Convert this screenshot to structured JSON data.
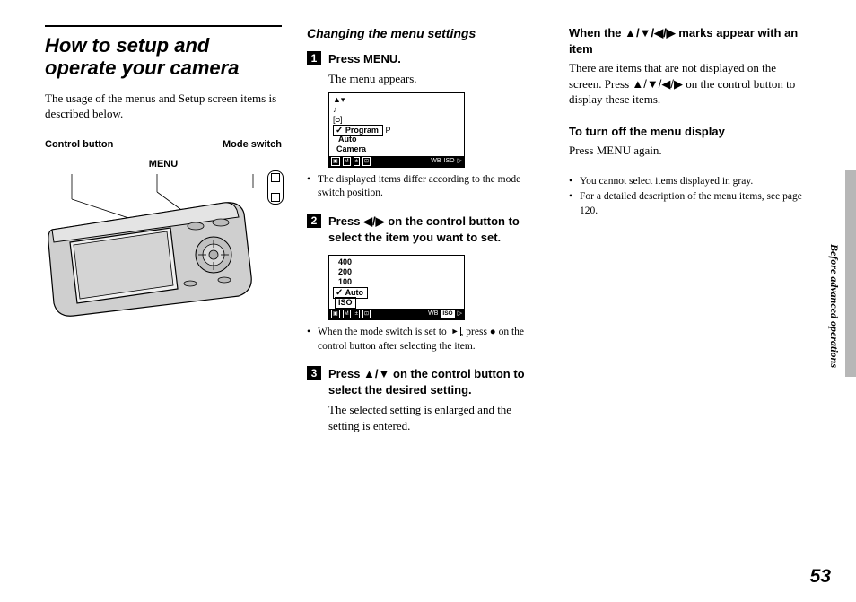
{
  "page_number": "53",
  "side_tab": "Before advanced operations",
  "col1": {
    "title": "How to setup and operate your camera",
    "intro": "The usage of the menus and Setup screen items is described below.",
    "labels": {
      "control_button": "Control button",
      "mode_switch": "Mode switch",
      "menu": "MENU"
    }
  },
  "col2": {
    "heading": "Changing the menu settings",
    "steps": [
      {
        "num": "1",
        "head": "Press MENU.",
        "body": "The menu appears."
      },
      {
        "num": "2",
        "head_prefix": "Press ",
        "head_arrows": "◀/▶",
        "head_suffix": " on the control button to select the item you want to set."
      },
      {
        "num": "3",
        "head_prefix": "Press ",
        "head_arrows": "▲/▼",
        "head_suffix": " on the control button to select the desired setting.",
        "body": "The selected setting is enlarged and the setting is entered."
      }
    ],
    "note1": "The displayed items differ according to the mode switch position.",
    "note2_pre": "When the mode switch is set to ",
    "note2_post": ", press ● on the control button after selecting the item.",
    "lcd1": {
      "rows_top": [
        "",
        "",
        ""
      ],
      "selected": "Program",
      "selected_suffix": "P",
      "rows_below": [
        "Auto",
        "Camera"
      ],
      "bar": {
        "wb": "WB",
        "iso": "ISO"
      }
    },
    "lcd2": {
      "rows_top": [
        "400",
        "200",
        "100"
      ],
      "selected": "Auto",
      "iso_label": "ISO",
      "bar": {
        "wb": "WB",
        "iso": "ISO"
      }
    }
  },
  "col3": {
    "h1_prefix": "When the ",
    "h1_arrows": "▲/▼/◀/▶",
    "h1_suffix": " marks appear with an item",
    "p1_pre": "There are items that are not displayed on the screen. Press ",
    "p1_arrows": "▲/▼/◀/▶",
    "p1_post": " on the control button to display these items.",
    "h2": "To turn off the menu display",
    "p2": "Press MENU again.",
    "notes": [
      "You cannot select items displayed in gray.",
      "For a detailed description of the menu items, see page 120."
    ]
  }
}
